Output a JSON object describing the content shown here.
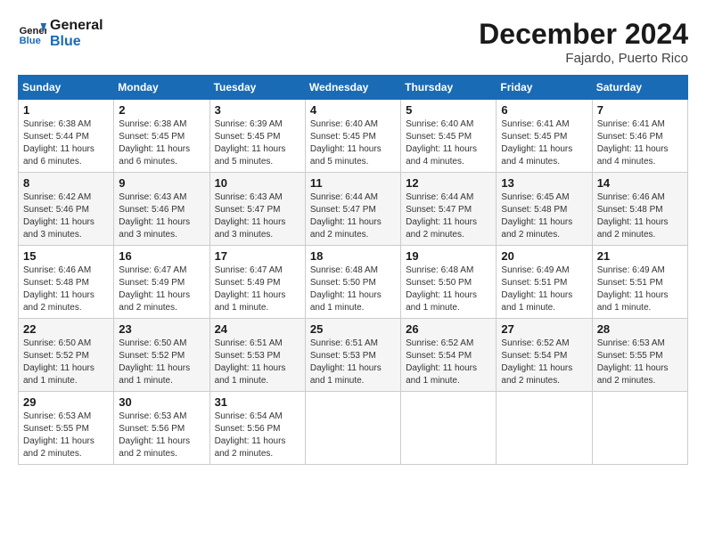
{
  "header": {
    "logo_line1": "General",
    "logo_line2": "Blue",
    "month": "December 2024",
    "location": "Fajardo, Puerto Rico"
  },
  "weekdays": [
    "Sunday",
    "Monday",
    "Tuesday",
    "Wednesday",
    "Thursday",
    "Friday",
    "Saturday"
  ],
  "weeks": [
    [
      {
        "day": "1",
        "sunrise": "6:38 AM",
        "sunset": "5:44 PM",
        "daylight": "11 hours and 6 minutes."
      },
      {
        "day": "2",
        "sunrise": "6:38 AM",
        "sunset": "5:45 PM",
        "daylight": "11 hours and 6 minutes."
      },
      {
        "day": "3",
        "sunrise": "6:39 AM",
        "sunset": "5:45 PM",
        "daylight": "11 hours and 5 minutes."
      },
      {
        "day": "4",
        "sunrise": "6:40 AM",
        "sunset": "5:45 PM",
        "daylight": "11 hours and 5 minutes."
      },
      {
        "day": "5",
        "sunrise": "6:40 AM",
        "sunset": "5:45 PM",
        "daylight": "11 hours and 4 minutes."
      },
      {
        "day": "6",
        "sunrise": "6:41 AM",
        "sunset": "5:45 PM",
        "daylight": "11 hours and 4 minutes."
      },
      {
        "day": "7",
        "sunrise": "6:41 AM",
        "sunset": "5:46 PM",
        "daylight": "11 hours and 4 minutes."
      }
    ],
    [
      {
        "day": "8",
        "sunrise": "6:42 AM",
        "sunset": "5:46 PM",
        "daylight": "11 hours and 3 minutes."
      },
      {
        "day": "9",
        "sunrise": "6:43 AM",
        "sunset": "5:46 PM",
        "daylight": "11 hours and 3 minutes."
      },
      {
        "day": "10",
        "sunrise": "6:43 AM",
        "sunset": "5:47 PM",
        "daylight": "11 hours and 3 minutes."
      },
      {
        "day": "11",
        "sunrise": "6:44 AM",
        "sunset": "5:47 PM",
        "daylight": "11 hours and 2 minutes."
      },
      {
        "day": "12",
        "sunrise": "6:44 AM",
        "sunset": "5:47 PM",
        "daylight": "11 hours and 2 minutes."
      },
      {
        "day": "13",
        "sunrise": "6:45 AM",
        "sunset": "5:48 PM",
        "daylight": "11 hours and 2 minutes."
      },
      {
        "day": "14",
        "sunrise": "6:46 AM",
        "sunset": "5:48 PM",
        "daylight": "11 hours and 2 minutes."
      }
    ],
    [
      {
        "day": "15",
        "sunrise": "6:46 AM",
        "sunset": "5:48 PM",
        "daylight": "11 hours and 2 minutes."
      },
      {
        "day": "16",
        "sunrise": "6:47 AM",
        "sunset": "5:49 PM",
        "daylight": "11 hours and 2 minutes."
      },
      {
        "day": "17",
        "sunrise": "6:47 AM",
        "sunset": "5:49 PM",
        "daylight": "11 hours and 1 minute."
      },
      {
        "day": "18",
        "sunrise": "6:48 AM",
        "sunset": "5:50 PM",
        "daylight": "11 hours and 1 minute."
      },
      {
        "day": "19",
        "sunrise": "6:48 AM",
        "sunset": "5:50 PM",
        "daylight": "11 hours and 1 minute."
      },
      {
        "day": "20",
        "sunrise": "6:49 AM",
        "sunset": "5:51 PM",
        "daylight": "11 hours and 1 minute."
      },
      {
        "day": "21",
        "sunrise": "6:49 AM",
        "sunset": "5:51 PM",
        "daylight": "11 hours and 1 minute."
      }
    ],
    [
      {
        "day": "22",
        "sunrise": "6:50 AM",
        "sunset": "5:52 PM",
        "daylight": "11 hours and 1 minute."
      },
      {
        "day": "23",
        "sunrise": "6:50 AM",
        "sunset": "5:52 PM",
        "daylight": "11 hours and 1 minute."
      },
      {
        "day": "24",
        "sunrise": "6:51 AM",
        "sunset": "5:53 PM",
        "daylight": "11 hours and 1 minute."
      },
      {
        "day": "25",
        "sunrise": "6:51 AM",
        "sunset": "5:53 PM",
        "daylight": "11 hours and 1 minute."
      },
      {
        "day": "26",
        "sunrise": "6:52 AM",
        "sunset": "5:54 PM",
        "daylight": "11 hours and 1 minute."
      },
      {
        "day": "27",
        "sunrise": "6:52 AM",
        "sunset": "5:54 PM",
        "daylight": "11 hours and 2 minutes."
      },
      {
        "day": "28",
        "sunrise": "6:53 AM",
        "sunset": "5:55 PM",
        "daylight": "11 hours and 2 minutes."
      }
    ],
    [
      {
        "day": "29",
        "sunrise": "6:53 AM",
        "sunset": "5:55 PM",
        "daylight": "11 hours and 2 minutes."
      },
      {
        "day": "30",
        "sunrise": "6:53 AM",
        "sunset": "5:56 PM",
        "daylight": "11 hours and 2 minutes."
      },
      {
        "day": "31",
        "sunrise": "6:54 AM",
        "sunset": "5:56 PM",
        "daylight": "11 hours and 2 minutes."
      },
      null,
      null,
      null,
      null
    ]
  ]
}
